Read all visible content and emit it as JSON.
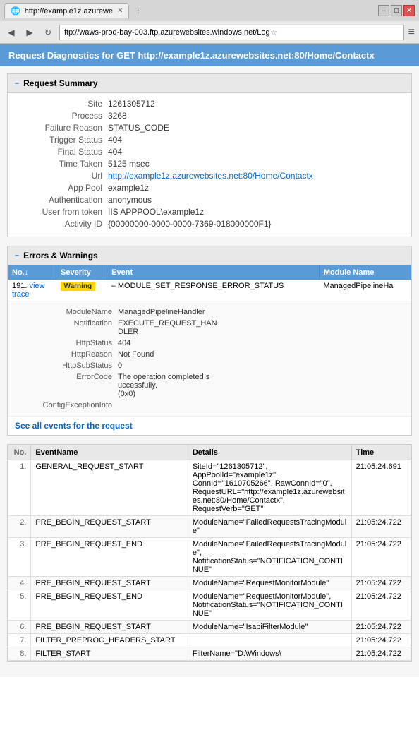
{
  "browser": {
    "tab_title": "http://example1z.azurewe",
    "address": "ftp://waws-prod-bay-003.ftp.azurewebsites.windows.net/Log",
    "win_minimize": "–",
    "win_maximize": "□",
    "win_close": "✕"
  },
  "page": {
    "header": "Request Diagnostics for GET http://example1z.azurewebsites.net:80/Home/Contactx"
  },
  "request_summary": {
    "title": "Request Summary",
    "fields": [
      {
        "label": "Site",
        "value": "1261305712"
      },
      {
        "label": "Process",
        "value": "3268"
      },
      {
        "label": "Failure Reason",
        "value": "STATUS_CODE"
      },
      {
        "label": "Trigger Status",
        "value": "404"
      },
      {
        "label": "Final Status",
        "value": "404"
      },
      {
        "label": "Time Taken",
        "value": "5125 msec"
      },
      {
        "label": "Url",
        "value": "http://example1z.azurewebsites.net:80/Home/Contactx",
        "link": true
      },
      {
        "label": "App Pool",
        "value": "example1z"
      },
      {
        "label": "Authentication",
        "value": "anonymous"
      },
      {
        "label": "User from token",
        "value": "IIS APPPOOL\\example1z"
      },
      {
        "label": "Activity ID",
        "value": "{00000000-0000-0000-7369-018000000F1}"
      }
    ]
  },
  "errors_warnings": {
    "title": "Errors & Warnings",
    "columns": [
      "No.↓",
      "Severity",
      "Event",
      "Module Name"
    ],
    "row_num": "191.",
    "view_trace": "view trace",
    "severity": "Warning",
    "event": "– MODULE_SET_RESPONSE_ERROR_STATUS",
    "module_name": "ManagedPipelineHa",
    "details": [
      {
        "label": "ModuleName",
        "value": "ManagedPipelineHandler"
      },
      {
        "label": "Notification",
        "value": "EXECUTE_REQUEST_HANDLER"
      },
      {
        "label": "HttpStatus",
        "value": "404"
      },
      {
        "label": "HttpReason",
        "value": "Not Found"
      },
      {
        "label": "HttpSubStatus",
        "value": "0"
      },
      {
        "label": "ErrorCode",
        "value": "The operation completed successfully. (0x0)"
      },
      {
        "label": "ConfigExceptionInfo",
        "value": ""
      }
    ],
    "see_all_link": "See all events for the request"
  },
  "events": {
    "columns": [
      "No.",
      "EventName",
      "Details",
      "Time"
    ],
    "rows": [
      {
        "num": "1.",
        "name": "GENERAL_REQUEST_START",
        "details": "SiteId=\"1261305712\", AppPoolId=\"example1z\", ConnId=\"1610705266\", RawConnId=\"0\", RequestURL=\"http://example1z.azurewebsites.net:80/Home/Contactx\", RequestVerb=\"GET\"",
        "time": "21:05:24.691"
      },
      {
        "num": "2.",
        "name": "PRE_BEGIN_REQUEST_START",
        "details": "ModuleName=\"FailedRequestsTracingModule\"",
        "time": "21:05:24.722"
      },
      {
        "num": "3.",
        "name": "PRE_BEGIN_REQUEST_END",
        "details": "ModuleName=\"FailedRequestsTracingModule\", NotificationStatus=\"NOTIFICATION_CONTINUE\"",
        "time": "21:05:24.722"
      },
      {
        "num": "4.",
        "name": "PRE_BEGIN_REQUEST_START",
        "details": "ModuleName=\"RequestMonitorModule\"",
        "time": "21:05:24.722"
      },
      {
        "num": "5.",
        "name": "PRE_BEGIN_REQUEST_END",
        "details": "ModuleName=\"RequestMonitorModule\", NotificationStatus=\"NOTIFICATION_CONTINUE\"",
        "time": "21:05:24.722"
      },
      {
        "num": "6.",
        "name": "PRE_BEGIN_REQUEST_START",
        "details": "ModuleName=\"IsapiFilterModule\"",
        "time": "21:05:24.722"
      },
      {
        "num": "7.",
        "name": "FILTER_PREPROC_HEADERS_START",
        "details": "",
        "time": "21:05:24.722"
      },
      {
        "num": "8.",
        "name": "FILTER_START",
        "details": "FilterName=\"D:\\Windows\\",
        "time": "21:05:24.722"
      }
    ]
  }
}
